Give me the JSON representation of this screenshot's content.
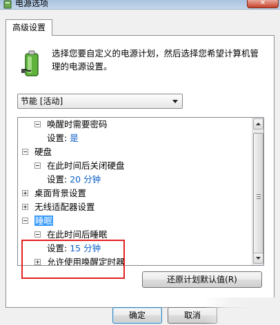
{
  "window": {
    "title": "电源选项",
    "close_label": "✕"
  },
  "tab": {
    "label": "高级设置"
  },
  "description": "选择您要自定义的电源计划，然后选择您希望计算机管理的电源设置。",
  "plan_select": {
    "value": "节能 [活动]"
  },
  "tree": {
    "rows": [
      {
        "label": "唤醒时需要密码",
        "expander": "minus"
      },
      {
        "label": "设置:",
        "value": "是"
      },
      {
        "label": "硬盘",
        "expander": "minus"
      },
      {
        "label": "在此时间后关闭硬盘",
        "expander": "minus"
      },
      {
        "label": "设置:",
        "value": "20 分钟"
      },
      {
        "label": "桌面背景设置",
        "expander": "plus"
      },
      {
        "label": "无线适配器设置",
        "expander": "plus"
      },
      {
        "label": "睡眠",
        "expander": "minus",
        "selected": true
      },
      {
        "label": "在此时间后睡眠",
        "expander": "minus"
      },
      {
        "label": "设置:",
        "value": "15 分钟"
      },
      {
        "label": "允许使用唤醒定时器",
        "expander": "plus"
      }
    ]
  },
  "buttons": {
    "restore_defaults": "还原计划默认值(R)",
    "ok": "确定",
    "cancel": "取消"
  },
  "colors": {
    "highlight_border": "#e21f1f",
    "selection": "#3399ff",
    "value_text": "#0b5ec7"
  }
}
